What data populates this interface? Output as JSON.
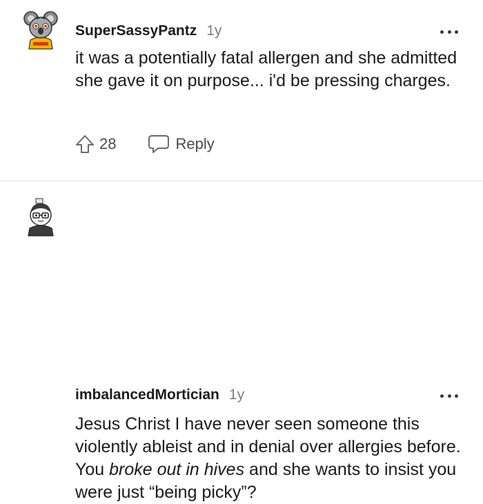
{
  "comments": [
    {
      "username": "SuperSassyPantz",
      "age": "1y",
      "body": "it was a potentially fatal allergen and she admitted she gave it on purpose... i'd be pressing charges.",
      "score": "28",
      "reply_label": "Reply",
      "avatar_icon": "koala-avatar-icon",
      "more_icon": "more-options-icon"
    },
    {
      "username": "imbalancedMortician",
      "age": "1y",
      "body_parts": {
        "before": "Jesus Christ I have never seen someone this violently ableist and in denial over allergies before. You ",
        "emphasis": "broke out in hives",
        "after": " and she wants to insist you were just “being picky”?"
      },
      "avatar_icon": "glasses-avatar-icon",
      "more_icon": "more-options-icon"
    }
  ],
  "colors": {
    "text": "#1c1c1c",
    "meta": "#7c7c7c",
    "action": "#4a4a4a",
    "divider": "#e6e6e6",
    "avatar_accent": "#d93a00"
  }
}
